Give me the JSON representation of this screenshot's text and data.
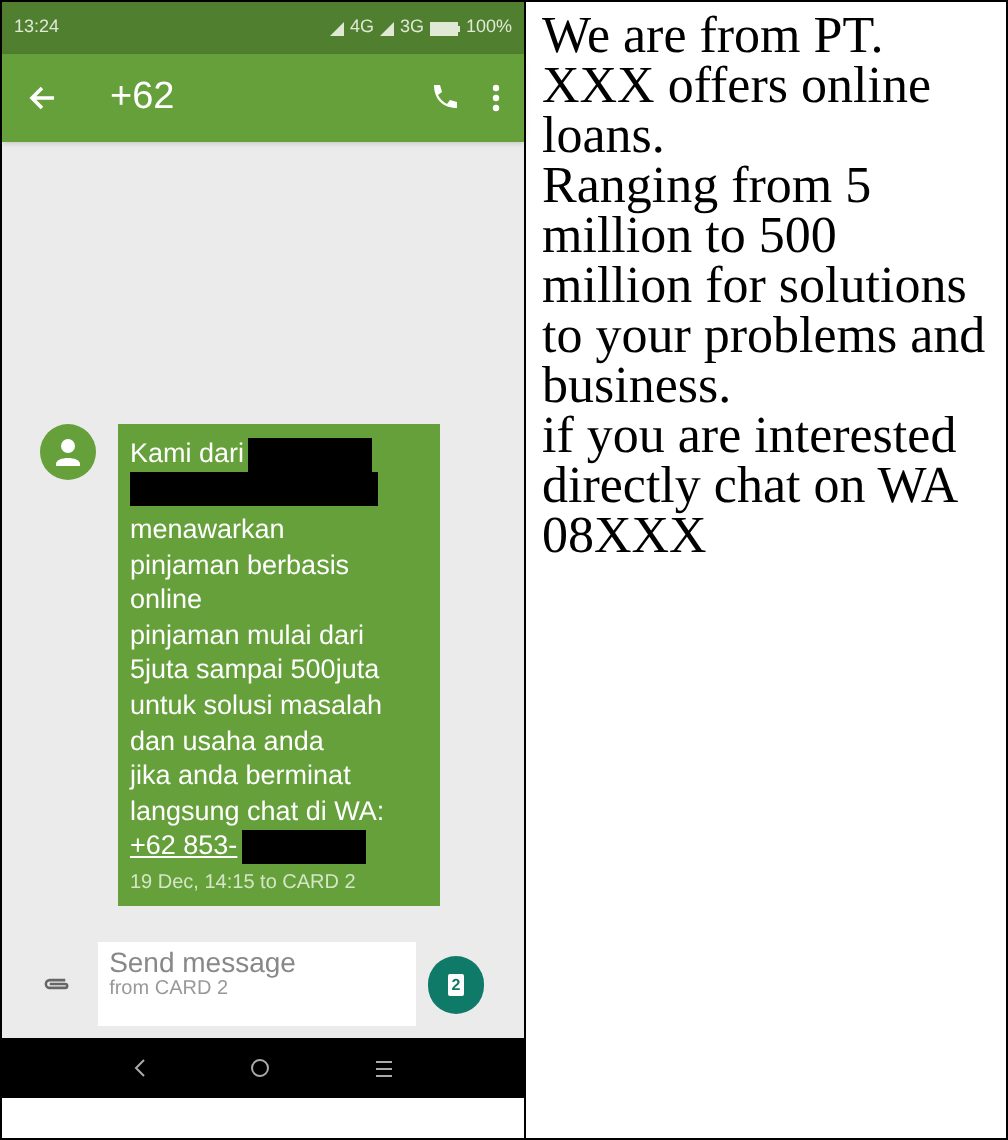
{
  "status_bar": {
    "time": "13:24",
    "networks": [
      "4G",
      "3G"
    ],
    "battery": "100%"
  },
  "app_bar": {
    "title": "+62"
  },
  "message": {
    "segments": [
      {
        "kind": "text",
        "text": "Kami dari"
      },
      {
        "kind": "redacted_inline"
      },
      {
        "kind": "redacted_line"
      },
      {
        "kind": "text",
        "text": "menawarkan"
      },
      {
        "kind": "text",
        "text": "pinjaman berbasis"
      },
      {
        "kind": "text",
        "text": "online"
      },
      {
        "kind": "text",
        "text": "pinjaman mulai dari"
      },
      {
        "kind": "text",
        "text": "5juta sampai 500juta"
      },
      {
        "kind": "text",
        "text": "untuk solusi masalah"
      },
      {
        "kind": "text",
        "text": "dan usaha anda"
      },
      {
        "kind": "text",
        "text": "jika anda berminat"
      },
      {
        "kind": "text",
        "text": "langsung chat di WA:"
      },
      {
        "kind": "link",
        "text": "+62 853-"
      },
      {
        "kind": "redacted_inline"
      }
    ],
    "meta": "19 Dec, 14:15 to CARD 2"
  },
  "compose": {
    "placeholder": "Send message",
    "sub": "from CARD 2",
    "sim": "2"
  },
  "translation": [
    "We are from PT. XXX offers online loans.",
    "Ranging from 5 million to 500 million for solutions to your problems and business.",
    "if you are interested directly chat on WA 08XXX"
  ]
}
